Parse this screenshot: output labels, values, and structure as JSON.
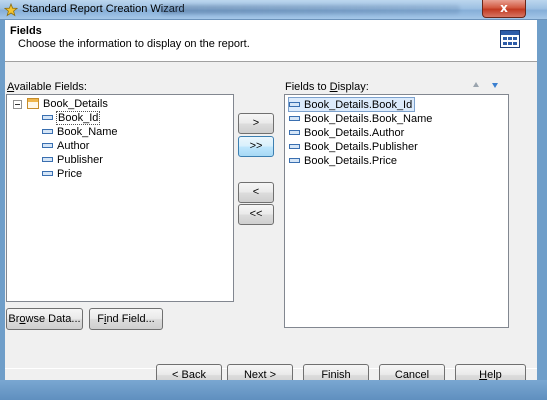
{
  "window": {
    "title": "Standard Report Creation Wizard",
    "close_label": "x"
  },
  "header": {
    "title": "Fields",
    "subtitle": "Choose the information to display on the report."
  },
  "available_fields": {
    "label_pre": "",
    "label_accel": "A",
    "label_post": "vailable Fields:",
    "table": "Book_Details",
    "fields": [
      "Book_Id",
      "Book_Name",
      "Author",
      "Publisher",
      "Price"
    ],
    "selected": "Book_Id"
  },
  "display_fields": {
    "label_pre": "Fields to ",
    "label_accel": "D",
    "label_post": "isplay:",
    "items": [
      "Book_Details.Book_Id",
      "Book_Details.Book_Name",
      "Book_Details.Author",
      "Book_Details.Publisher",
      "Book_Details.Price"
    ],
    "selected": "Book_Details.Book_Id"
  },
  "transfer_buttons": {
    "add_one": ">",
    "add_all": ">>",
    "remove_one": "<",
    "remove_all": "<<"
  },
  "tool_buttons": {
    "browse_pre": "Br",
    "browse_accel": "o",
    "browse_post": "wse Data...",
    "find_pre": "F",
    "find_accel": "i",
    "find_post": "nd Field..."
  },
  "nav_buttons": {
    "back": "< Back",
    "next": "Next >",
    "finish": "Finish",
    "cancel": "Cancel",
    "help_accel": "H",
    "help_post": "elp"
  },
  "icons": {
    "app": "wizard-icon",
    "report": "report-grid-icon",
    "move_up": "arrow-up-icon",
    "move_down": "arrow-down-icon",
    "table": "table-icon",
    "field": "field-icon"
  },
  "colors": {
    "selection_outline": "#7da2ce",
    "selection_fill": "#dcebfc",
    "down_arrow": "#3a7fd0"
  }
}
